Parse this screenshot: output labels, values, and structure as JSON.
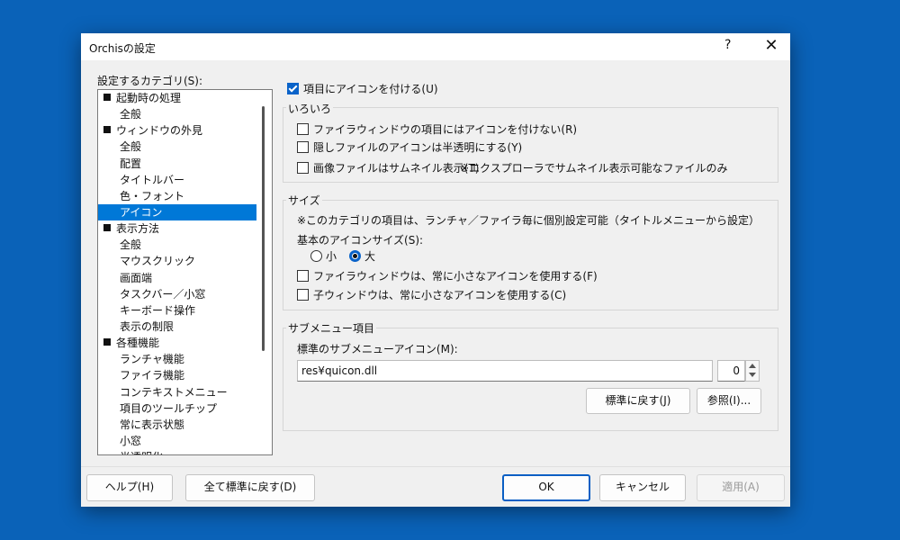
{
  "dialog": {
    "title": "Orchisの設定",
    "help_glyph": "?",
    "close_glyph": "✕"
  },
  "categories": {
    "label": "設定するカテゴリ(S):",
    "items": [
      {
        "label": "起動時の処理",
        "level": 0
      },
      {
        "label": "全般",
        "level": 1
      },
      {
        "label": "ウィンドウの外見",
        "level": 0
      },
      {
        "label": "全般",
        "level": 1
      },
      {
        "label": "配置",
        "level": 1
      },
      {
        "label": "タイトルバー",
        "level": 1
      },
      {
        "label": "色・フォント",
        "level": 1
      },
      {
        "label": "アイコン",
        "level": 1,
        "selected": true
      },
      {
        "label": "表示方法",
        "level": 0
      },
      {
        "label": "全般",
        "level": 1
      },
      {
        "label": "マウスクリック",
        "level": 1
      },
      {
        "label": "画面端",
        "level": 1
      },
      {
        "label": "タスクバー／小窓",
        "level": 1
      },
      {
        "label": "キーボード操作",
        "level": 1
      },
      {
        "label": "表示の制限",
        "level": 1
      },
      {
        "label": "各種機能",
        "level": 0
      },
      {
        "label": "ランチャ機能",
        "level": 1
      },
      {
        "label": "ファイラ機能",
        "level": 1
      },
      {
        "label": "コンテキストメニュー",
        "level": 1
      },
      {
        "label": "項目のツールチップ",
        "level": 1
      },
      {
        "label": "常に表示状態",
        "level": 1
      },
      {
        "label": "小窓",
        "level": 1
      },
      {
        "label": "半透明化",
        "level": 1
      }
    ]
  },
  "main": {
    "top_check": {
      "label": "項目にアイコンを付ける(U)",
      "checked": true
    },
    "misc": {
      "title": "いろいろ",
      "no_icon_check": {
        "label": "ファイラウィンドウの項目にはアイコンを付けない(R)",
        "checked": false
      },
      "hidden_check": {
        "label": "隠しファイルのアイコンは半透明にする(Y)",
        "checked": false
      },
      "thumb_check": {
        "label": "画像ファイルはサムネイル表示(T)",
        "checked": false
      },
      "thumb_note": "※エクスプローラでサムネイル表示可能なファイルのみ"
    },
    "size": {
      "title": "サイズ",
      "note": "※このカテゴリの項目は、ランチャ／ファイラ毎に個別設定可能（タイトルメニューから設定）",
      "basic_label": "基本のアイコンサイズ(S):",
      "radio_small": "小",
      "radio_large": "大",
      "selected": "大",
      "filer_small_check": {
        "label": "ファイラウィンドウは、常に小さなアイコンを使用する(F)",
        "checked": false
      },
      "child_small_check": {
        "label": "子ウィンドウは、常に小さなアイコンを使用する(C)",
        "checked": false
      }
    },
    "submenu": {
      "title": "サブメニュー項目",
      "std_label": "標準のサブメニューアイコン(M):",
      "path_value": "res¥quicon.dll",
      "index_value": "0",
      "reset_button": "標準に戻す(J)",
      "browse_button": "参照(I)..."
    }
  },
  "footer": {
    "help": "ヘルプ(H)",
    "reset_all": "全て標準に戻す(D)",
    "ok": "OK",
    "cancel": "キャンセル",
    "apply": "適用(A)"
  },
  "colors": {
    "desktop": "#0a62b8",
    "selection": "#0078d7",
    "accent": "#0a63c9"
  }
}
